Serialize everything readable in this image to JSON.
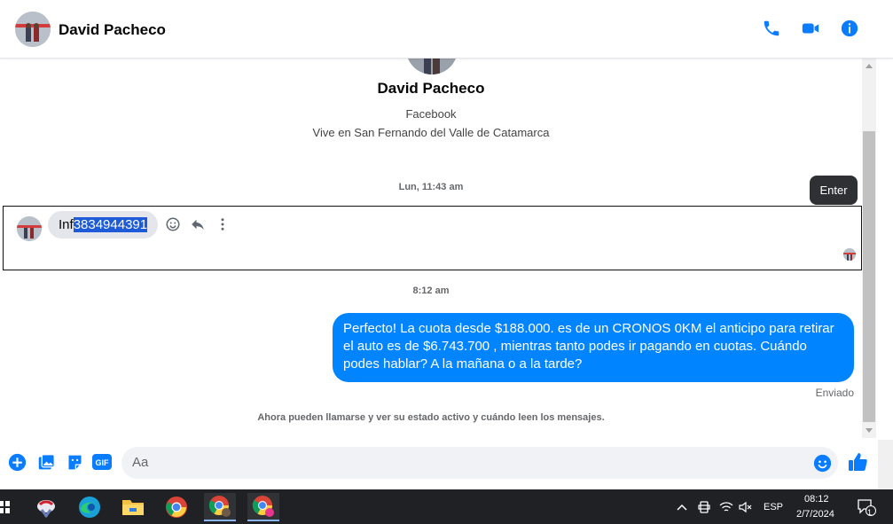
{
  "header": {
    "contact_name": "David Pacheco",
    "icons": [
      "phone-icon",
      "video-icon",
      "info-icon"
    ]
  },
  "profile": {
    "name": "David Pacheco",
    "source": "Facebook",
    "location": "Vive en San Fernando del Valle de Catamarca"
  },
  "messages": {
    "timestamp_1": "Lun, 11:43 am",
    "received": {
      "prefix": "Inf",
      "selected": "3834944391"
    },
    "tooltip": "Enter",
    "timestamp_2": "8:12 am",
    "sent": "Perfecto! La cuota desde $188.000. es de un CRONOS 0KM el anticipo para retirar el auto es de $6.743.700 , mientras tanto podes ir pagando en cuotas. Cuándo podes hablar? A la mañana o a la tarde?",
    "status": "Enviado",
    "info_note": "Ahora pueden llamarse y ver su estado activo y cuándo leen los mensajes."
  },
  "composer": {
    "placeholder": "Aa",
    "gif_label": "GIF",
    "icons": [
      "plus-icon",
      "image-icon",
      "sticker-icon",
      "gif-icon",
      "emoji-icon",
      "like-icon"
    ]
  },
  "taskbar": {
    "apps": [
      "snipping-tool",
      "edge",
      "file-explorer",
      "chrome",
      "chrome-profile-a",
      "chrome-profile-c"
    ],
    "language": "ESP",
    "time": "08:12",
    "date": "2/7/2024",
    "notifications": "1"
  },
  "colors": {
    "messenger_blue": "#0084ff",
    "header_icon_blue": "#0a7cff",
    "selection": "#1d5bd8",
    "taskbar": "#202124"
  }
}
